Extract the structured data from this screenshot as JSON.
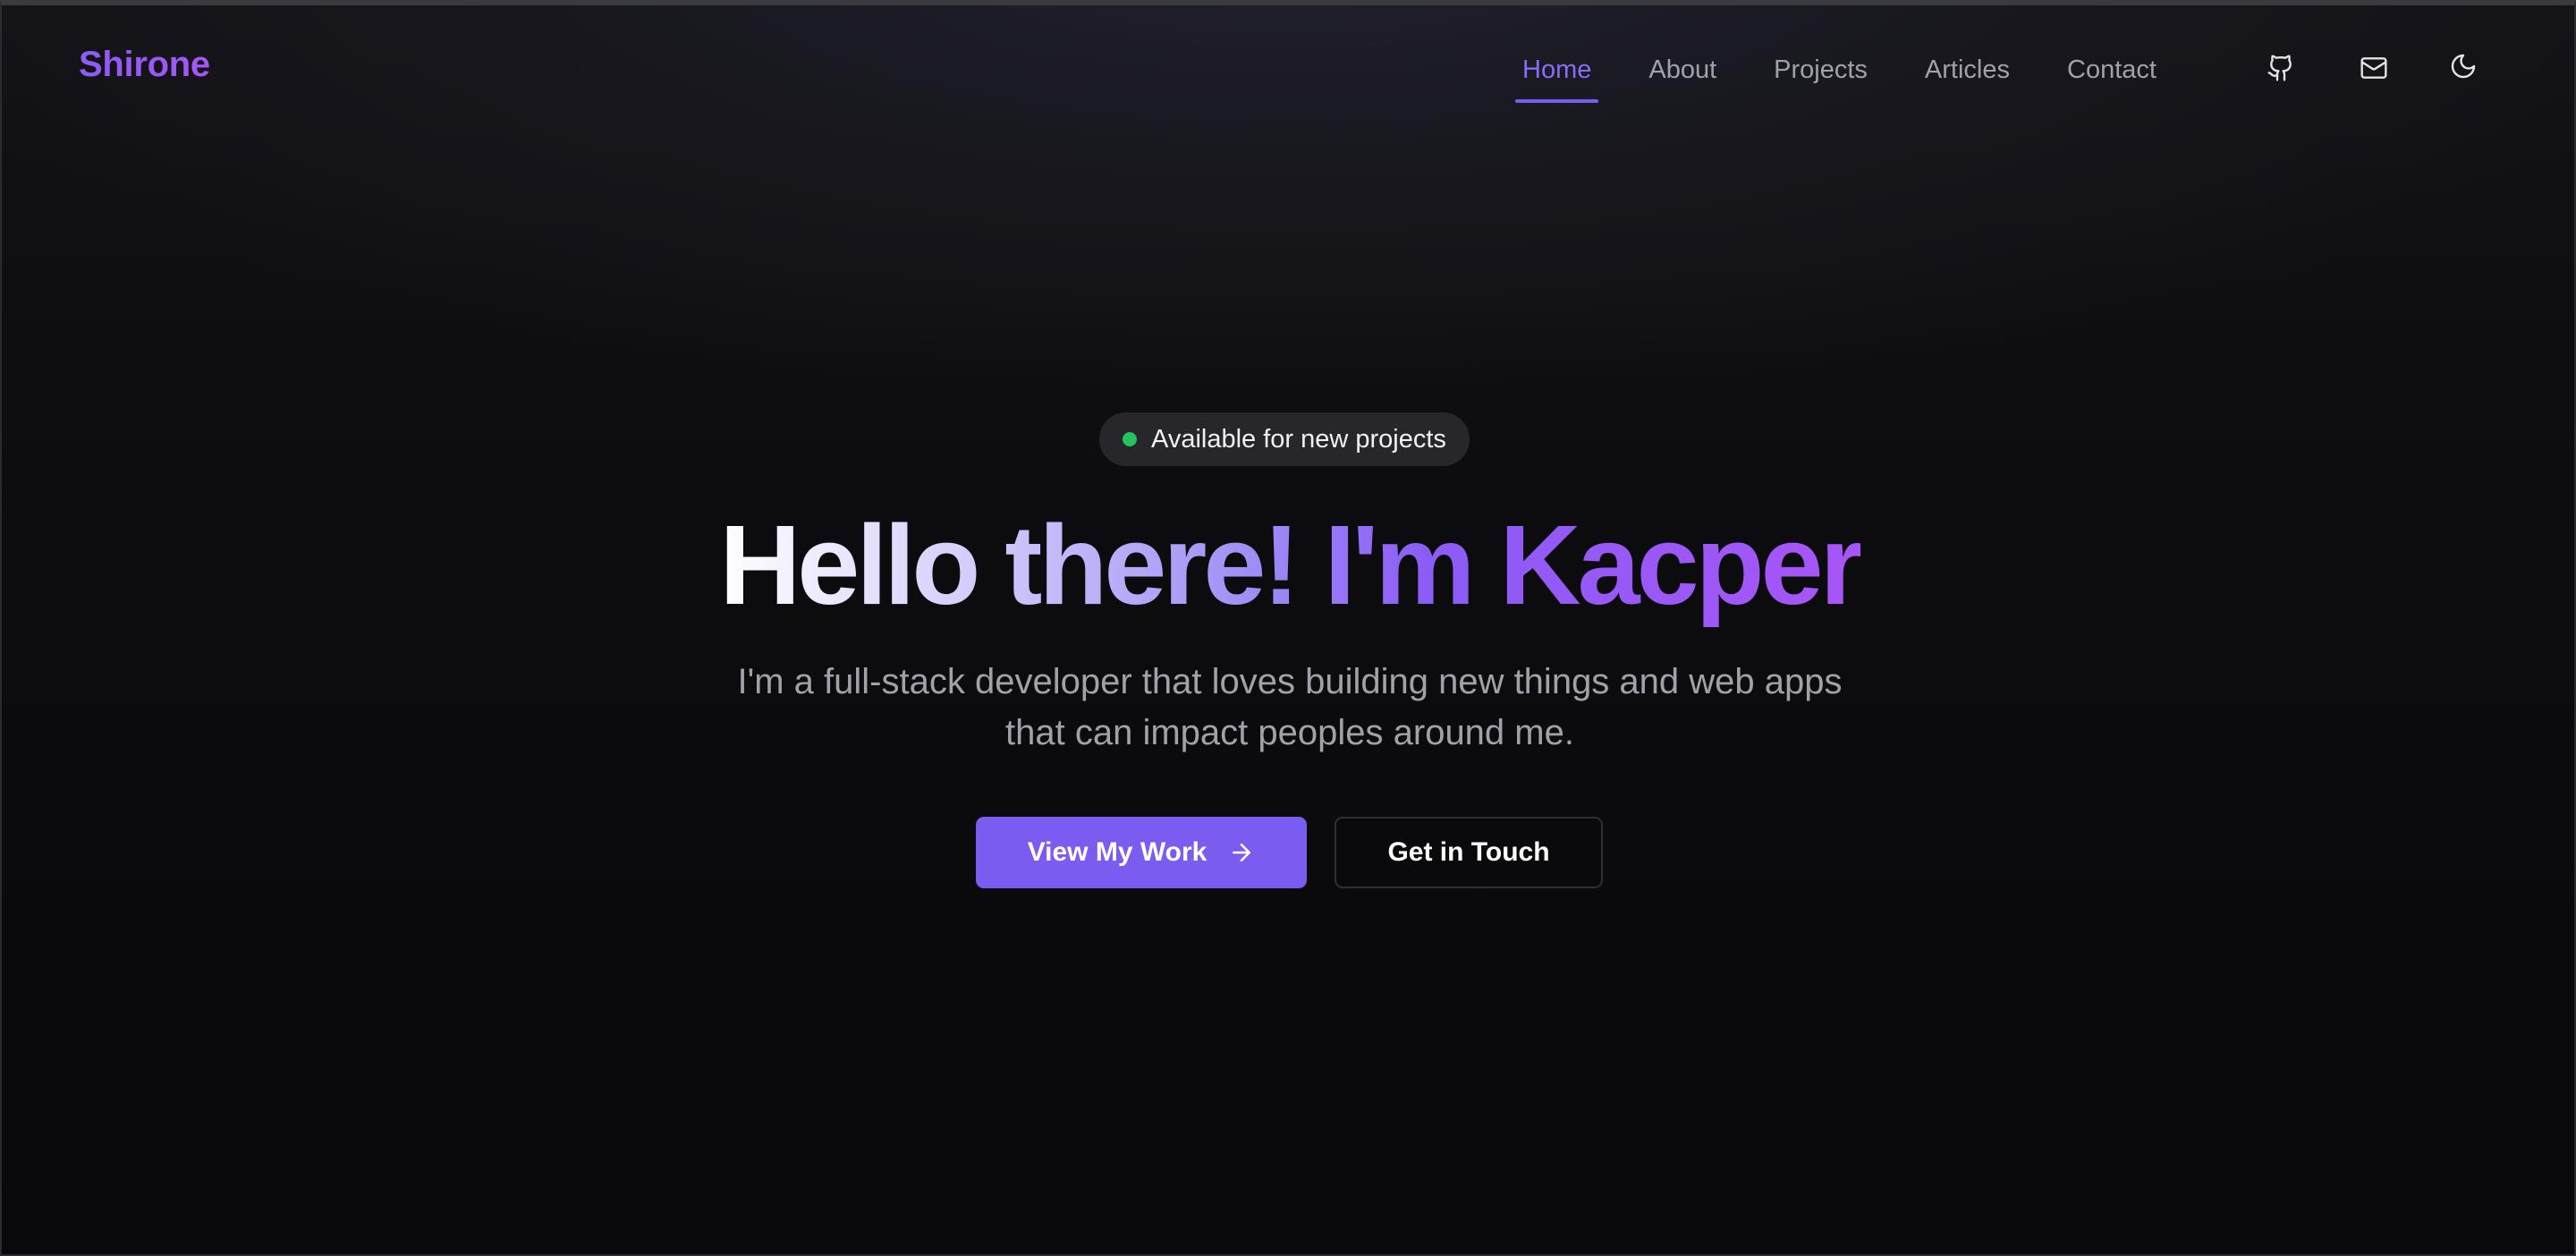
{
  "header": {
    "brand": "Shirone",
    "nav": [
      {
        "label": "Home",
        "active": true
      },
      {
        "label": "About"
      },
      {
        "label": "Projects"
      },
      {
        "label": "Articles"
      },
      {
        "label": "Contact"
      }
    ],
    "icons": [
      "github-icon",
      "mail-icon",
      "moon-icon"
    ]
  },
  "hero": {
    "badge": "Available for new projects",
    "headline": "Hello there! I'm Kacper",
    "subtitle_line1": "I'm a full-stack developer that loves building new things and web apps",
    "subtitle_line2": "that can impact peoples around me.",
    "primary_button": "View My Work",
    "secondary_button": "Get in Touch"
  },
  "colors": {
    "accent": "#7a5cf0",
    "brand_gradient_start": "#8b5cf6",
    "brand_gradient_end": "#a855f7",
    "status_available": "#22c55e",
    "background": "#0b0b0e"
  }
}
